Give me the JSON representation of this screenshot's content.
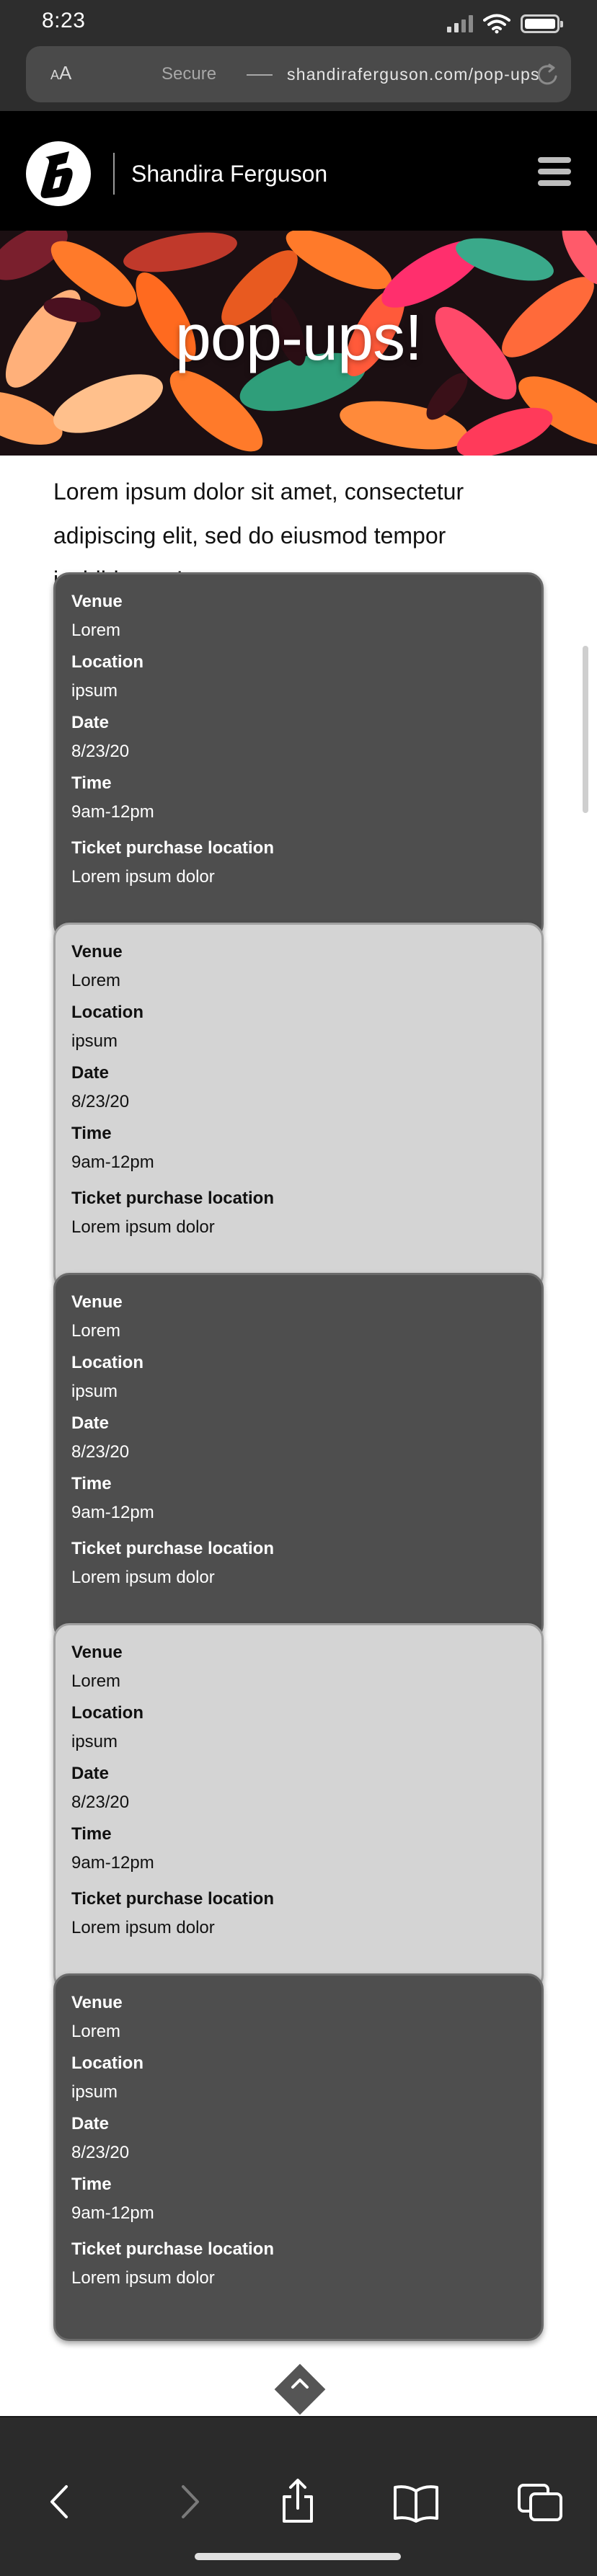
{
  "status_bar": {
    "time": "8:23"
  },
  "address_bar": {
    "text_size_label": "A",
    "text_size_label_large": "A",
    "secure_label": "Secure",
    "url": "shandiraferguson.com/pop-ups"
  },
  "site_header": {
    "site_name": "Shandira Ferguson"
  },
  "hero": {
    "title": "pop-ups!"
  },
  "intro": {
    "text": "Lorem ipsum dolor sit amet, consectetur adipiscing elit, sed do eiusmod tempor incididunt ut!"
  },
  "events": [
    {
      "theme": "dark",
      "venue_label": "Venue",
      "venue": "Lorem",
      "location_label": "Location",
      "location": "ipsum",
      "date_label": "Date",
      "date": "8/23/20",
      "time_label": "Time",
      "time": "9am-12pm",
      "ticket_label": "Ticket purchase location",
      "ticket": "Lorem ipsum dolor"
    },
    {
      "theme": "light",
      "venue_label": "Venue",
      "venue": "Lorem",
      "location_label": "Location",
      "location": "ipsum",
      "date_label": "Date",
      "date": "8/23/20",
      "time_label": "Time",
      "time": "9am-12pm",
      "ticket_label": "Ticket purchase location",
      "ticket": "Lorem ipsum dolor"
    },
    {
      "theme": "dark",
      "venue_label": "Venue",
      "venue": "Lorem",
      "location_label": "Location",
      "location": "ipsum",
      "date_label": "Date",
      "date": "8/23/20",
      "time_label": "Time",
      "time": "9am-12pm",
      "ticket_label": "Ticket purchase location",
      "ticket": "Lorem ipsum dolor"
    },
    {
      "theme": "light",
      "venue_label": "Venue",
      "venue": "Lorem",
      "location_label": "Location",
      "location": "ipsum",
      "date_label": "Date",
      "date": "8/23/20",
      "time_label": "Time",
      "time": "9am-12pm",
      "ticket_label": "Ticket purchase location",
      "ticket": "Lorem ipsum dolor"
    },
    {
      "theme": "dark",
      "venue_label": "Venue",
      "venue": "Lorem",
      "location_label": "Location",
      "location": "ipsum",
      "date_label": "Date",
      "date": "8/23/20",
      "time_label": "Time",
      "time": "9am-12pm",
      "ticket_label": "Ticket purchase location",
      "ticket": "Lorem ipsum dolor"
    }
  ],
  "icons": {
    "status": [
      "signal-icon",
      "wifi-icon",
      "battery-icon"
    ],
    "address_bar": [
      "text-size-icon",
      "reload-icon"
    ],
    "header": [
      "logo-icon",
      "menu-icon"
    ],
    "page": [
      "back-to-top-icon"
    ],
    "toolbar": [
      "back-arrow-icon",
      "forward-arrow-icon",
      "share-icon",
      "bookmarks-icon",
      "tabs-icon"
    ]
  },
  "colors": {
    "header_background": "#000000",
    "card_dark": "#4e4e4e",
    "card_light": "#d4d4d4",
    "hero_orange": "#ff6a1f",
    "hero_pink": "#ff2f6d",
    "hero_green": "#2f9e7a",
    "hero_peach": "#ffb07a"
  }
}
